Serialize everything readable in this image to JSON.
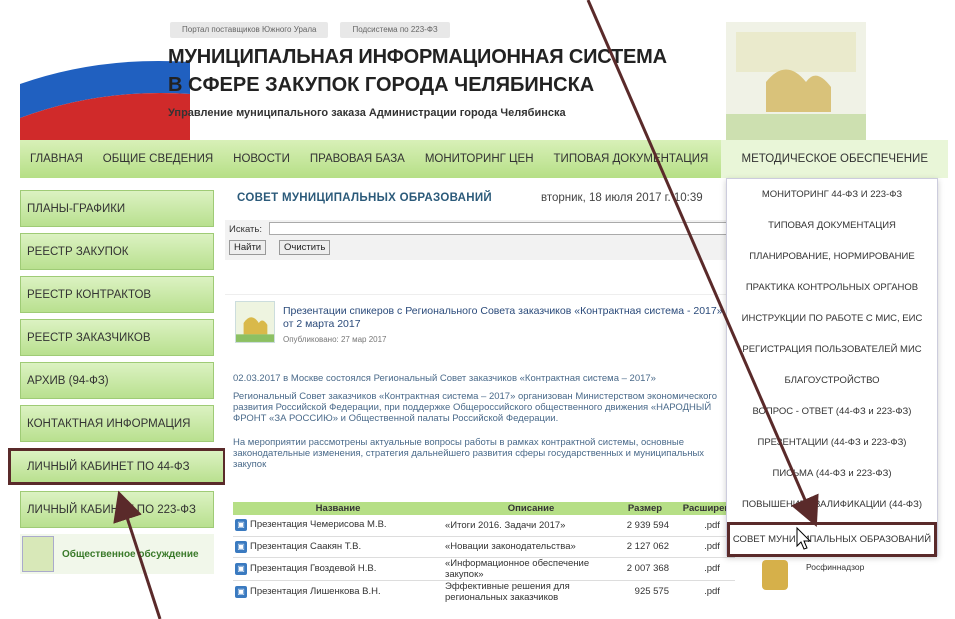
{
  "header": {
    "toplinks": [
      "Портал поставщиков Южного Урала",
      "Подсистема по 223-ФЗ"
    ],
    "title_line1": "МУНИЦИПАЛЬНАЯ ИНФОРМАЦИОННАЯ СИСТЕМА",
    "title_line2": "В СФЕРЕ ЗАКУПОК ГОРОДА ЧЕЛЯБИНСКА",
    "subtitle": "Управление муниципального заказа Администрации города Челябинска"
  },
  "nav": {
    "items": [
      "ГЛАВНАЯ",
      "ОБЩИЕ СВЕДЕНИЯ",
      "НОВОСТИ",
      "ПРАВОВАЯ БАЗА",
      "МОНИТОРИНГ ЦЕН",
      "ТИПОВАЯ ДОКУМЕНТАЦИЯ",
      "МЕТОДИЧЕСКОЕ ОБЕСПЕЧЕНИЕ"
    ]
  },
  "sidebar": {
    "items": [
      "ПЛАНЫ-ГРАФИКИ",
      "РЕЕСТР ЗАКУПОК",
      "РЕЕСТР КОНТРАКТОВ",
      "РЕЕСТР ЗАКАЗЧИКОВ",
      "АРХИВ (94-ФЗ)",
      "КОНТАКТНАЯ ИНФОРМАЦИЯ",
      "ЛИЧНЫЙ КАБИНЕТ ПО 44-ФЗ",
      "ЛИЧНЫЙ КАБИНЕТ ПО 223-ФЗ"
    ],
    "footer_label": "Общественное обсуждение"
  },
  "main": {
    "page_title": "СОВЕТ МУНИЦИПАЛЬНЫХ ОБРАЗОВАНИЙ",
    "date": "вторник, 18 июля 2017 г. 10:39",
    "search_label": "Искать:",
    "search_value": "",
    "find_button": "Найти",
    "clear_button": "Очистить",
    "news_title": "Презентации спикеров с Регионального Совета заказчиков «Контрактная система - 2017» от 2 марта 2017",
    "published": "Опубликовано: 27 мар 2017",
    "para1": "02.03.2017 в Москве состоялся Региональный Совет заказчиков «Контрактная система – 2017»",
    "para2": "Региональный Совет заказчиков «Контрактная система – 2017» организован Министерством экономического развития Российской Федерации, при поддержке Общероссийского общественного движения «НАРОДНЫЙ ФРОНТ «ЗА РОССИЮ» и Общественной палаты Российской Федерации.",
    "para3": "На мероприятии рассмотрены актуальные вопросы работы в рамках контрактной системы, основные законодательные изменения, стратегия дальнейшего развития сферы государственных и муниципальных закупок",
    "table_headers": [
      "Название",
      "Описание",
      "Размер",
      "Расширение"
    ],
    "table_rows": [
      [
        "Презентация Чемерисова М.В.",
        "«Итоги 2016. Задачи 2017»",
        "2 939 594",
        ".pdf"
      ],
      [
        "Презентация Саакян Т.В.",
        "«Новации законодательства»",
        "2 127 062",
        ".pdf"
      ],
      [
        "Презентация Гвоздевой Н.В.",
        "«Информационное обеспечение закупок»",
        "2 007 368",
        ".pdf"
      ],
      [
        "Презентация Лишенкова В.Н.",
        "Эффективные решения для региональных заказчиков",
        "925 575",
        ".pdf"
      ]
    ]
  },
  "dropdown": {
    "items": [
      "МОНИТОРИНГ 44-ФЗ И 223-ФЗ",
      "ТИПОВАЯ ДОКУМЕНТАЦИЯ",
      "ПЛАНИРОВАНИЕ, НОРМИРОВАНИЕ",
      "ПРАКТИКА КОНТРОЛЬНЫХ ОРГАНОВ",
      "ИНСТРУКЦИИ ПО РАБОТЕ С МИС, ЕИС",
      "РЕГИСТРАЦИЯ ПОЛЬЗОВАТЕЛЕЙ МИС",
      "БЛАГОУСТРОЙСТВО",
      "ВОПРОС - ОТВЕТ (44-ФЗ и 223-ФЗ)",
      "ПРЕЗЕНТАЦИИ (44-ФЗ и 223-ФЗ)",
      "ПИСЬМА (44-ФЗ и 223-ФЗ)",
      "ПОВЫШЕНИЕ КВАЛИФИКАЦИИ (44-ФЗ)",
      "СОВЕТ МУНИЦИПАЛЬНЫХ ОБРАЗОВАНИЙ"
    ]
  },
  "right": {
    "rosfin_label": "Росфиннадзор"
  },
  "colors": {
    "nav_green": "#b6df86",
    "highlight_border": "#5a2a2a",
    "title_blue": "#2b5a7a"
  }
}
